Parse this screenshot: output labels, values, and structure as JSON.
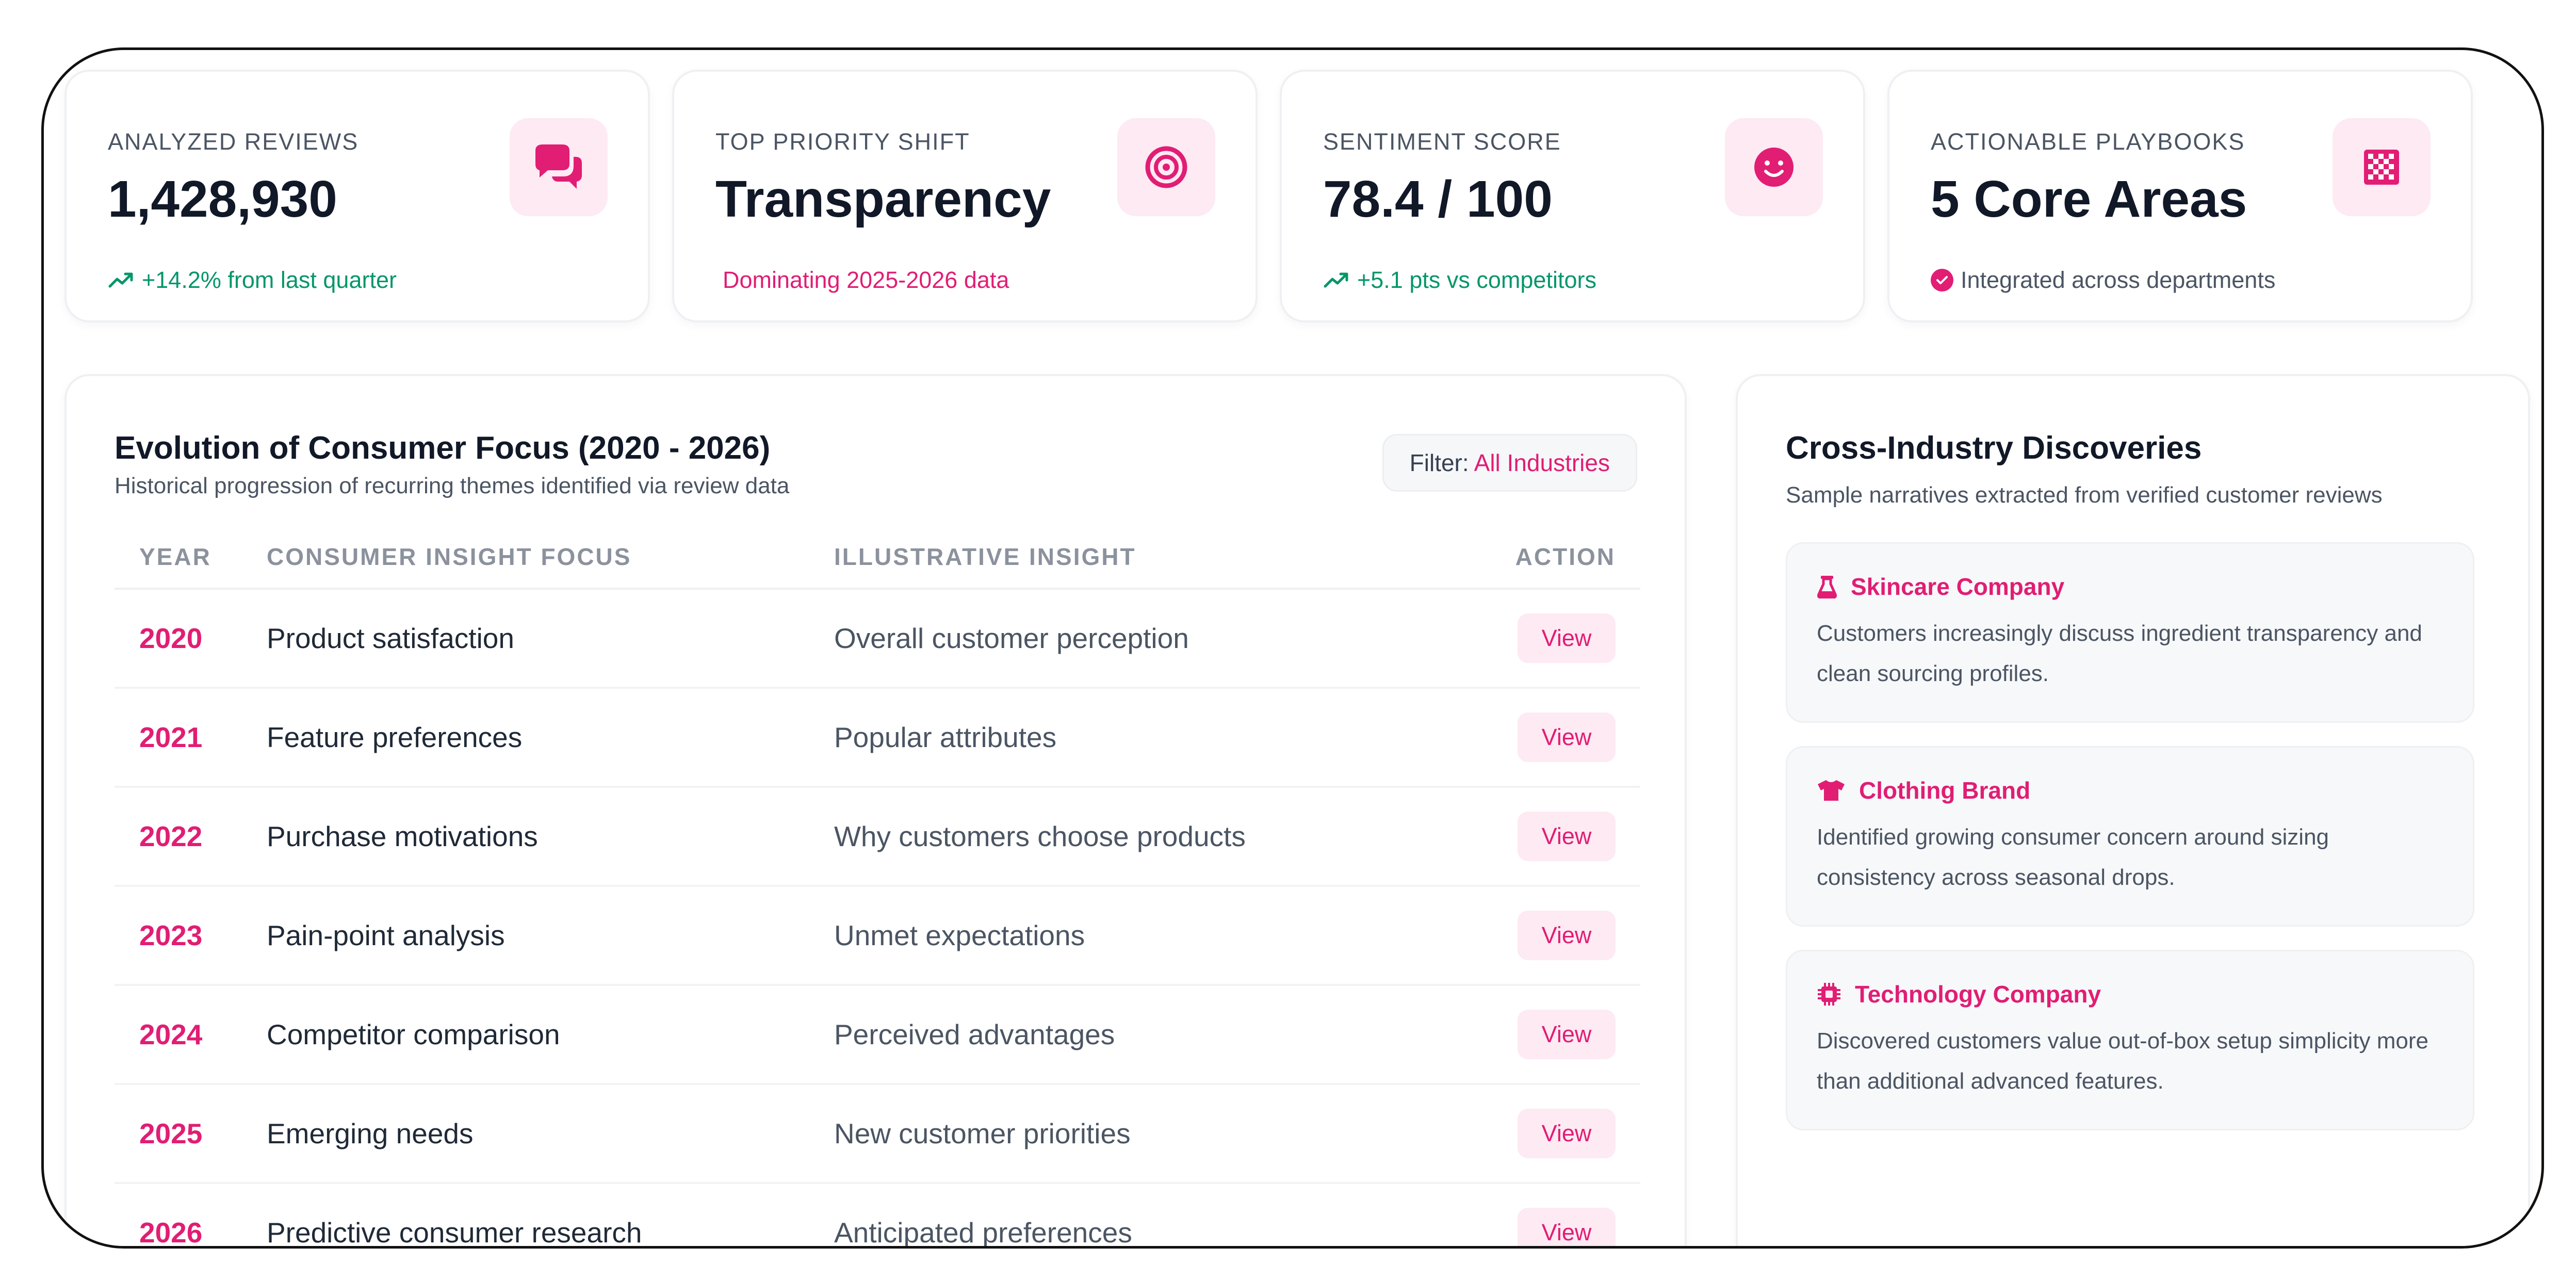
{
  "stats": [
    {
      "label": "ANALYZED REVIEWS",
      "value": "1,428,930",
      "icon": "chat-bubbles-icon",
      "sub": "+14.2% from last quarter",
      "sub_icon": "trend-up-icon",
      "sub_color": "#059669"
    },
    {
      "label": "TOP PRIORITY SHIFT",
      "value": "Transparency",
      "icon": "target-icon",
      "sub": "Dominating 2025-2026 data",
      "sub_color": "#e11d74"
    },
    {
      "label": "SENTIMENT SCORE",
      "value": "78.4 / 100",
      "icon": "smiley-icon",
      "sub": "+5.1 pts vs competitors",
      "sub_icon": "trend-up-icon",
      "sub_color": "#059669"
    },
    {
      "label": "ACTIONABLE PLAYBOOKS",
      "value": "5 Core Areas",
      "icon": "checkerboard-icon",
      "sub": "Integrated across departments",
      "sub_icon": "check-circle-icon",
      "sub_color": "#4b5563"
    }
  ],
  "evolution": {
    "title": "Evolution of Consumer Focus (2020 - 2026)",
    "subtitle": "Historical progression of recurring themes identified via review data",
    "filter_label": "Filter:",
    "filter_value": "All Industries",
    "columns": [
      "YEAR",
      "CONSUMER INSIGHT FOCUS",
      "ILLUSTRATIVE INSIGHT",
      "ACTION"
    ],
    "rows": [
      {
        "year": "2020",
        "focus": "Product satisfaction",
        "insight": "Overall customer perception",
        "action": "View"
      },
      {
        "year": "2021",
        "focus": "Feature preferences",
        "insight": "Popular attributes",
        "action": "View"
      },
      {
        "year": "2022",
        "focus": "Purchase motivations",
        "insight": "Why customers choose products",
        "action": "View"
      },
      {
        "year": "2023",
        "focus": "Pain-point analysis",
        "insight": "Unmet expectations",
        "action": "View"
      },
      {
        "year": "2024",
        "focus": "Competitor comparison",
        "insight": "Perceived advantages",
        "action": "View"
      },
      {
        "year": "2025",
        "focus": "Emerging needs",
        "insight": "New customer priorities",
        "action": "View"
      },
      {
        "year": "2026",
        "focus": "Predictive consumer research",
        "insight": "Anticipated preferences",
        "action": "View"
      }
    ]
  },
  "discoveries": {
    "title": "Cross-Industry Discoveries",
    "subtitle": "Sample narratives extracted from verified customer reviews",
    "items": [
      {
        "company": "Skincare Company",
        "icon": "flask-icon",
        "text": "Customers increasingly discuss ingredient transparency and clean sourcing profiles."
      },
      {
        "company": "Clothing Brand",
        "icon": "shirt-icon",
        "text": "Identified growing consumer concern around sizing consistency across seasonal drops."
      },
      {
        "company": "Technology Company",
        "icon": "chip-icon",
        "text": "Discovered customers value out-of-box setup simplicity more than additional advanced features."
      }
    ]
  },
  "colors": {
    "accent": "#e11d74",
    "accent_soft": "#fdeaf3",
    "positive": "#059669"
  }
}
